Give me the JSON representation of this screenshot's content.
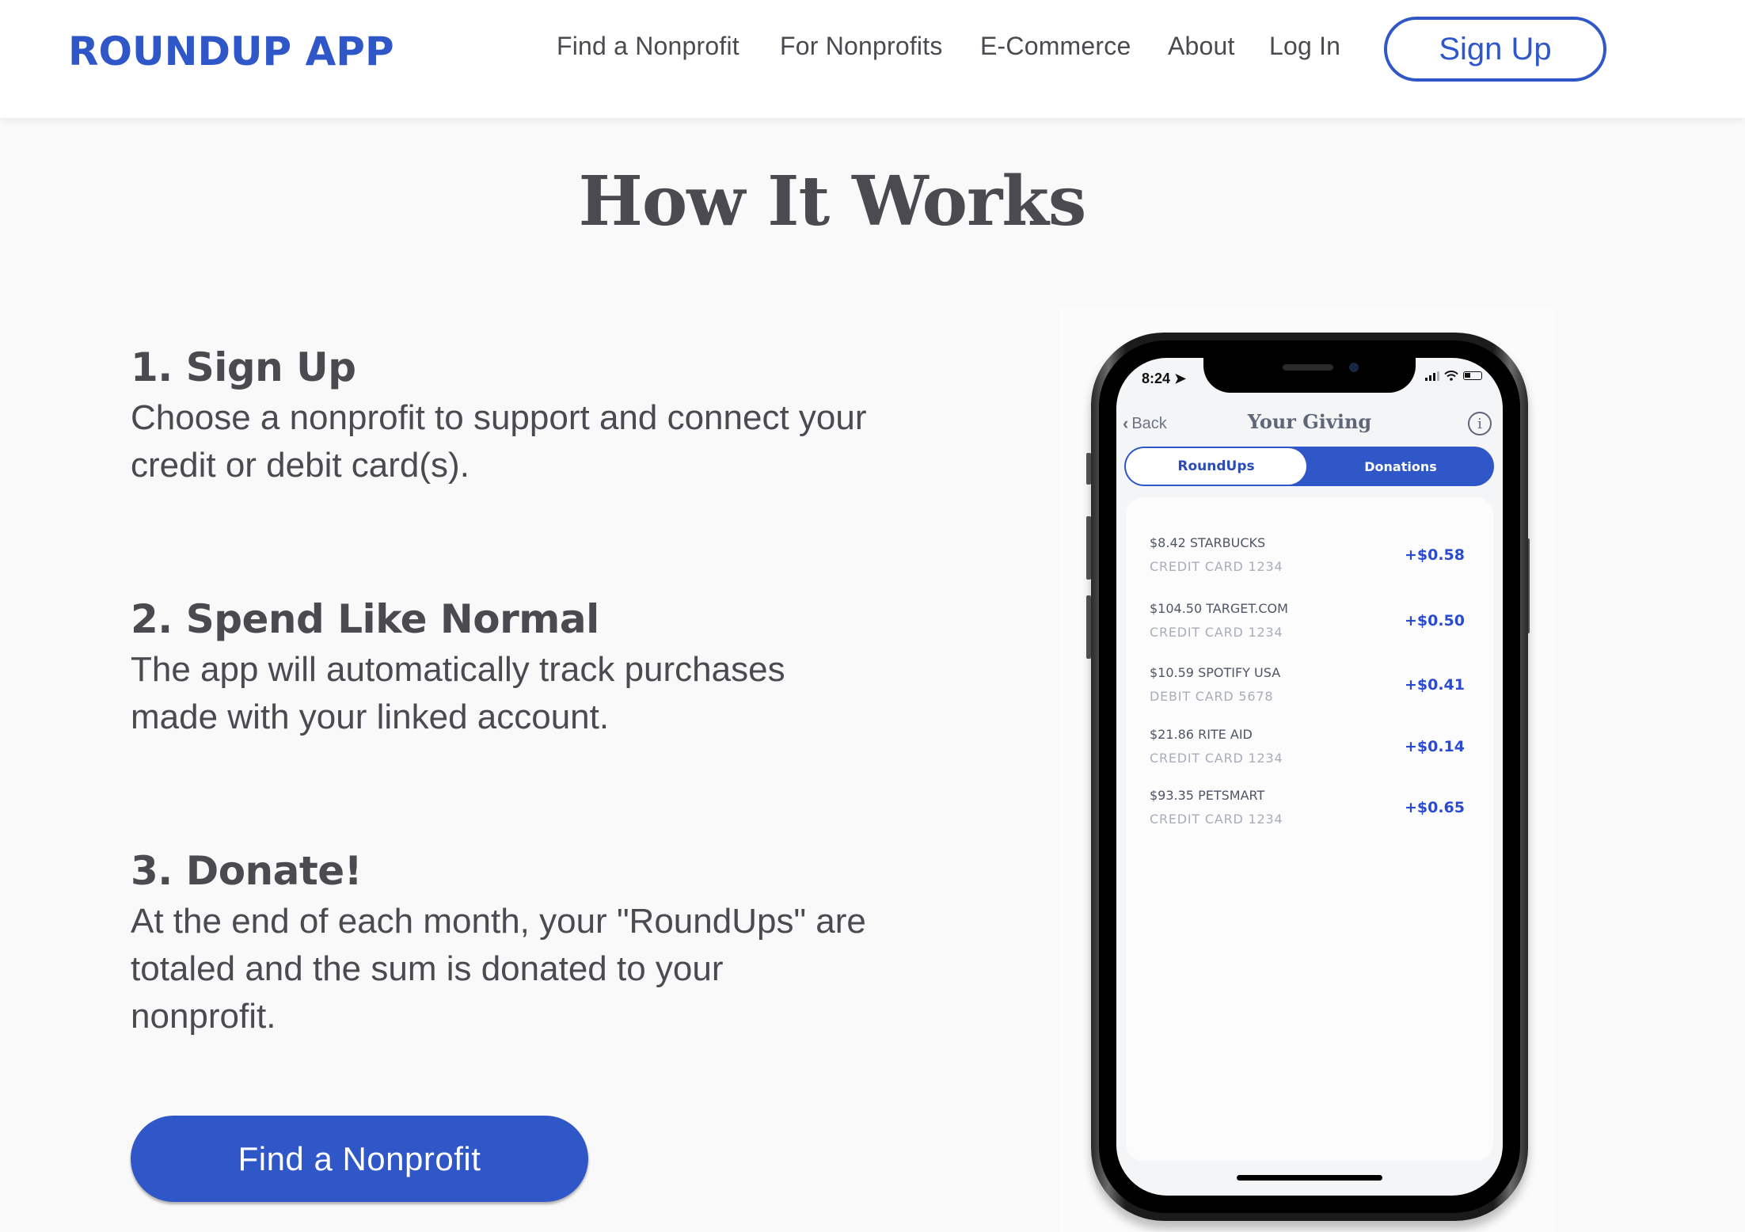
{
  "header": {
    "logo": "ROUNDUP APP",
    "nav": [
      {
        "label": "Find a Nonprofit"
      },
      {
        "label": "For Nonprofits"
      },
      {
        "label": "E-Commerce"
      },
      {
        "label": "About"
      },
      {
        "label": "Log In"
      }
    ],
    "signup_label": "Sign Up"
  },
  "main": {
    "title": "How It Works",
    "steps": [
      {
        "heading": "1. Sign Up",
        "body": "Choose a nonprofit to support and connect your credit or debit card(s)."
      },
      {
        "heading": "2. Spend Like Normal",
        "body": "The app will automatically track purchases made with your linked account."
      },
      {
        "heading": "3. Donate!",
        "body": "At the end of each month, your \"RoundUps\" are totaled and the sum is donated to your nonprofit."
      }
    ],
    "cta_label": "Find a Nonprofit"
  },
  "phone": {
    "status_time": "8:24",
    "back_label": "Back",
    "screen_title": "Your Giving",
    "info_glyph": "i",
    "tabs": [
      {
        "label": "RoundUps",
        "active": true
      },
      {
        "label": "Donations",
        "active": false
      }
    ],
    "transactions": [
      {
        "name": "$8.42 STARBUCKS",
        "card": "CREDIT CARD 1234",
        "roundup": "+$0.58"
      },
      {
        "name": "$104.50 TARGET.COM",
        "card": "CREDIT CARD 1234",
        "roundup": "+$0.50"
      },
      {
        "name": "$10.59 SPOTIFY USA",
        "card": "DEBIT CARD 5678",
        "roundup": "+$0.41"
      },
      {
        "name": "$21.86 RITE AID",
        "card": "CREDIT CARD 1234",
        "roundup": "+$0.14"
      },
      {
        "name": "$93.35 PETSMART",
        "card": "CREDIT CARD 1234",
        "roundup": "+$0.65"
      }
    ]
  },
  "colors": {
    "brand_blue": "#3057c8",
    "text_dark": "#4a4a50",
    "page_bg": "#f9f9f9"
  }
}
